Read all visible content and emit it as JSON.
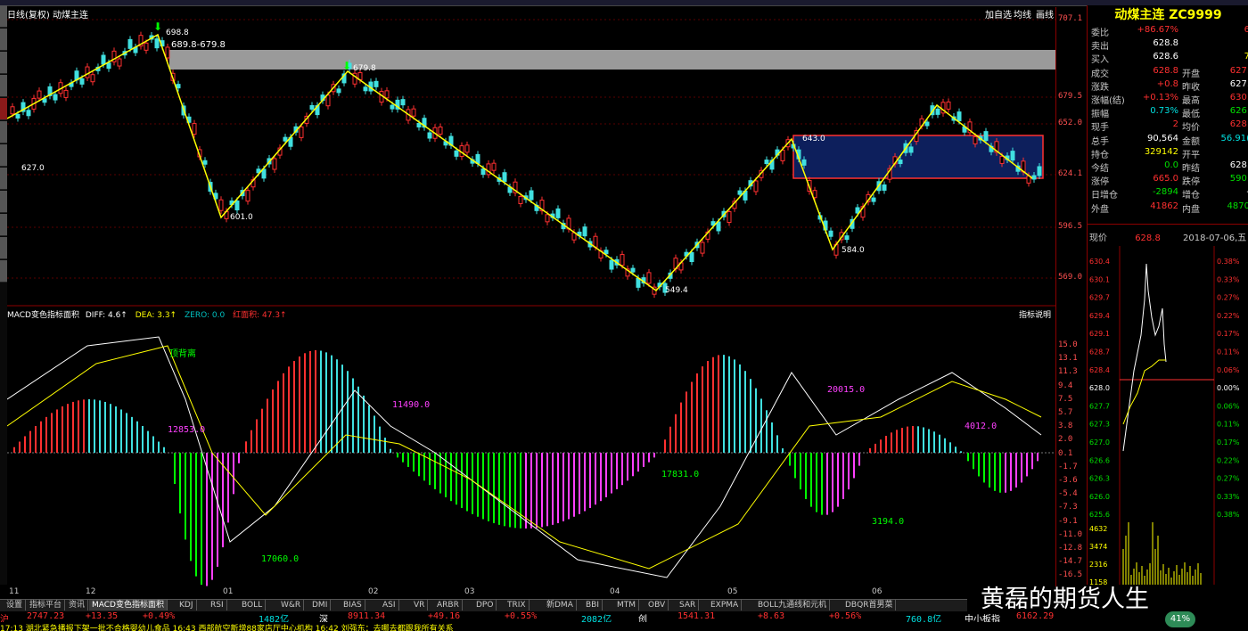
{
  "window": {
    "title": "日线(复权) 动煤主连",
    "buttons": [
      "加自选",
      "均线",
      "画线"
    ]
  },
  "price_axis": [
    "707.1",
    "679.5",
    "652.0",
    "624.1",
    "596.5",
    "569.0"
  ],
  "macd_axis": [
    "15.0",
    "13.1",
    "11.3",
    "9.4",
    "7.5",
    "5.7",
    "3.8",
    "2.0",
    "0.1",
    "-1.7",
    "-3.6",
    "-5.4",
    "-7.3",
    "-9.1",
    "-11.0",
    "-12.8",
    "-14.7",
    "-16.5"
  ],
  "annotations": {
    "p1": "698.8",
    "range": "689.8-679.8",
    "p2": "679.8",
    "p3": "627.0",
    "p4": "601.0",
    "p5": "643.0",
    "p6": "584.0",
    "p7": "549.4"
  },
  "macd": {
    "title": "MACD变色指标面积",
    "diff": "DIFF: 4.6↑",
    "dea": "DEA: 3.3↑",
    "zero": "ZERO: 0.0",
    "area": "红面积: 47.3↑",
    "help": "指标说明",
    "divergence": "顶背离",
    "areas": [
      "12853.0",
      "11490.0",
      "17060.0",
      "17831.0",
      "20015.0",
      "3194.0",
      "4012.0"
    ]
  },
  "x_axis": [
    "11",
    "12",
    "01",
    "02",
    "03",
    "04",
    "05",
    "06"
  ],
  "panel": {
    "name": "动煤主连 ZC9999",
    "rows": [
      {
        "l": "委比",
        "v": "+86.67%",
        "c": "red",
        "l2": "",
        "v2": "6",
        "c2": "red"
      },
      {
        "l": "卖出",
        "v": "628.8",
        "c": "wht",
        "l2": "",
        "v2": "",
        "c2": "wht"
      },
      {
        "l": "买入",
        "v": "628.6",
        "c": "wht",
        "l2": "",
        "v2": "7",
        "c2": "yel"
      },
      {
        "l": "成交",
        "v": "628.8",
        "c": "red",
        "l2": "开盘",
        "v2": "627.",
        "c2": "red"
      },
      {
        "l": "涨跌",
        "v": "+0.8",
        "c": "red",
        "l2": "昨收",
        "v2": "627.",
        "c2": "wht"
      },
      {
        "l": "涨幅(结)",
        "v": "+0.13%",
        "c": "red",
        "l2": "最高",
        "v2": "630.",
        "c2": "red"
      },
      {
        "l": "振幅",
        "v": "0.73%",
        "c": "cyn",
        "l2": "最低",
        "v2": "626.",
        "c2": "grn"
      },
      {
        "l": "现手",
        "v": "2",
        "c": "red",
        "l2": "均价",
        "v2": "628.",
        "c2": "red"
      },
      {
        "l": "总手",
        "v": "90,564",
        "c": "wht",
        "l2": "金额",
        "v2": "56.91(",
        "c2": "cyn"
      },
      {
        "l": "持仓",
        "v": "329142",
        "c": "yel",
        "l2": "开平",
        "v2": "",
        "c2": "wht"
      },
      {
        "l": "今结",
        "v": "0.0",
        "c": "grn",
        "l2": "昨结",
        "v2": "628.",
        "c2": "wht"
      },
      {
        "l": "涨停",
        "v": "665.0",
        "c": "red",
        "l2": "跌停",
        "v2": "590.",
        "c2": "grn"
      },
      {
        "l": "日增仓",
        "v": "-2894",
        "c": "grn",
        "l2": "增仓",
        "v2": "-",
        "c2": "wht"
      },
      {
        "l": "外盘",
        "v": "41862",
        "c": "red",
        "l2": "内盘",
        "v2": "4870",
        "c2": "grn"
      }
    ],
    "now_label": "现价",
    "now_value": "628.8",
    "date": "2018-07-06,五",
    "mini_left": [
      "630.4",
      "630.1",
      "629.7",
      "629.4",
      "629.1",
      "628.7",
      "628.4",
      "628.0",
      "627.7",
      "627.3",
      "627.0",
      "626.6",
      "626.3",
      "626.0",
      "625.6"
    ],
    "mini_right": [
      "0.38%",
      "0.33%",
      "0.27%",
      "0.22%",
      "0.17%",
      "0.11%",
      "0.06%",
      "0.00%",
      "0.06%",
      "0.11%",
      "0.17%",
      "0.22%",
      "0.27%",
      "0.33%",
      "0.38%"
    ],
    "vol_labels": [
      "4632",
      "3474",
      "2316",
      "1158"
    ]
  },
  "tabs": [
    "设置",
    "指标平台",
    "资讯",
    "MACD变色指标面积",
    "KDJ",
    "RSI",
    "BOLL",
    "W&R",
    "DMI",
    "BIAS",
    "ASI",
    "VR",
    "ARBR",
    "DPO",
    "TRIX",
    "新DMA",
    "BBI",
    "MTM",
    "OBV",
    "SAR",
    "EXPMA",
    "BOLL九通线和元机",
    "DBQR首男菜"
  ],
  "index_bar": [
    {
      "t": "沪",
      "c": "red"
    },
    {
      "t": "2747.23",
      "c": "red"
    },
    {
      "t": "+13.35",
      "c": "red"
    },
    {
      "t": "+0.49%",
      "c": "red"
    },
    {
      "t": "1482亿",
      "c": "cyn"
    },
    {
      "t": "深",
      "c": "wht"
    },
    {
      "t": "8911.34",
      "c": "red"
    },
    {
      "t": "+49.16",
      "c": "red"
    },
    {
      "t": "+0.55%",
      "c": "red"
    },
    {
      "t": "2082亿",
      "c": "cyn"
    },
    {
      "t": "创",
      "c": "wht"
    },
    {
      "t": "1541.31",
      "c": "red"
    },
    {
      "t": "+8.63",
      "c": "red"
    },
    {
      "t": "+0.56%",
      "c": "red"
    },
    {
      "t": "760.8亿",
      "c": "cyn"
    },
    {
      "t": "中小板指",
      "c": "wht"
    },
    {
      "t": "6162.29",
      "c": "red"
    }
  ],
  "news": "17:13 湖北紧急播报下架一批不合格婴幼儿食品  16:43 西部航空新增88家店厅中心机构    16:42 刘强东：去哪去都跟我所有关系",
  "watermark": "黄磊的期货人生",
  "badge": "41%"
}
